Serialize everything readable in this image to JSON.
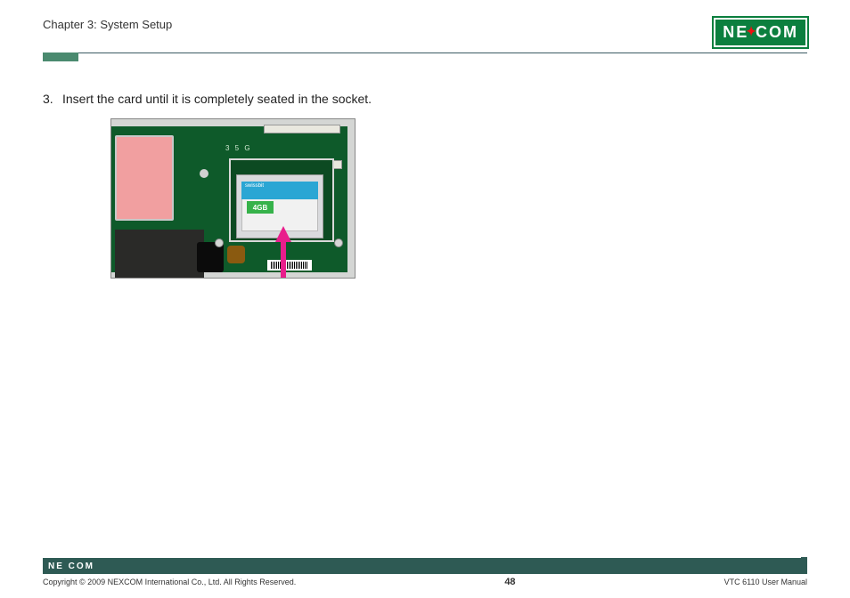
{
  "header": {
    "chapter_title": "Chapter 3: System Setup",
    "logo_text_left": "NE",
    "logo_text_right": "COM"
  },
  "body": {
    "step_number": "3.",
    "step_text": "Insert the card until it is completely seated in the socket."
  },
  "photo": {
    "silk_label": "3 5 G",
    "card_brand": "swissbit",
    "card_capacity": "4GB"
  },
  "footer": {
    "logo_text": "NE COM",
    "copyright": "Copyright © 2009 NEXCOM International Co., Ltd. All Rights Reserved.",
    "page_number": "48",
    "doc_title": "VTC 6110 User Manual"
  }
}
